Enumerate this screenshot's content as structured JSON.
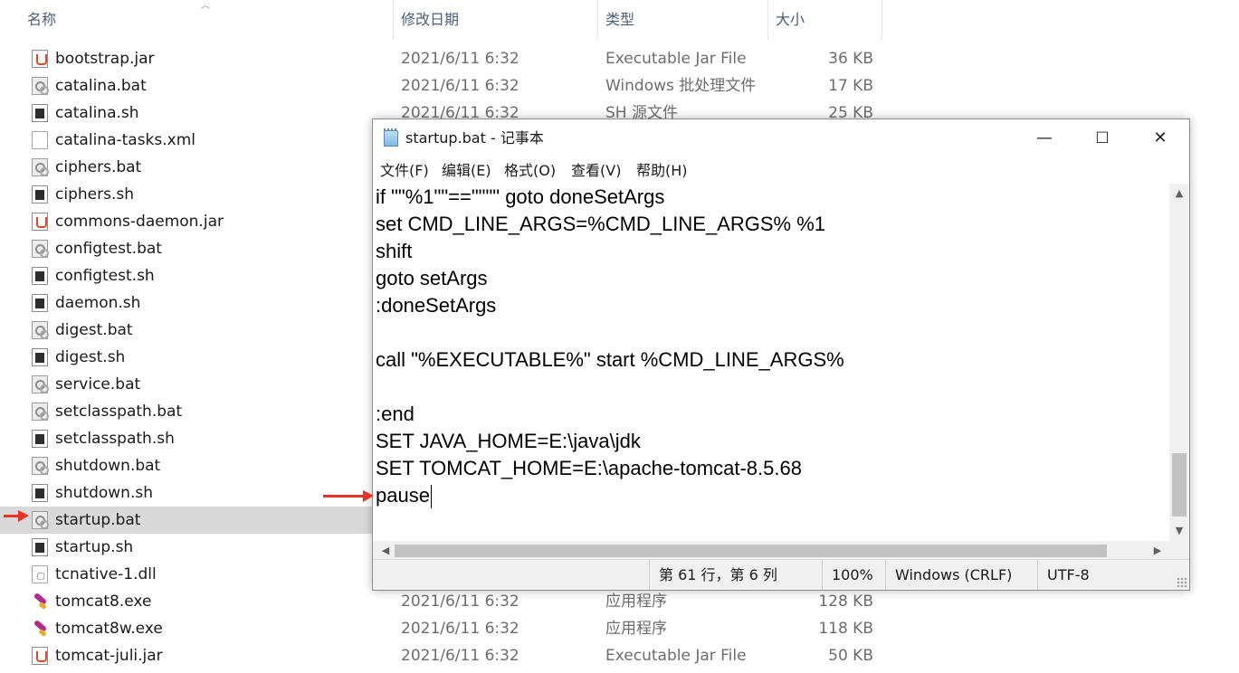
{
  "explorer": {
    "columns": {
      "name": "名称",
      "date": "修改日期",
      "type": "类型",
      "size": "大小"
    },
    "files": [
      {
        "name": "bootstrap.jar",
        "date": "2021/6/11 6:32",
        "type": "Executable Jar File",
        "size": "36 KB",
        "icon": "jar-file-icon"
      },
      {
        "name": "catalina.bat",
        "date": "2021/6/11 6:32",
        "type": "Windows 批处理文件",
        "size": "17 KB",
        "icon": "batch-file-icon"
      },
      {
        "name": "catalina.sh",
        "date": "2021/6/11 6:32",
        "type": "SH 源文件",
        "size": "25 KB",
        "icon": "shell-file-icon"
      },
      {
        "name": "catalina-tasks.xml",
        "date": "",
        "type": "",
        "size": "",
        "icon": "xml-file-icon"
      },
      {
        "name": "ciphers.bat",
        "date": "",
        "type": "",
        "size": "",
        "icon": "batch-file-icon"
      },
      {
        "name": "ciphers.sh",
        "date": "",
        "type": "",
        "size": "",
        "icon": "shell-file-icon"
      },
      {
        "name": "commons-daemon.jar",
        "date": "",
        "type": "",
        "size": "",
        "icon": "jar-file-icon"
      },
      {
        "name": "configtest.bat",
        "date": "",
        "type": "",
        "size": "",
        "icon": "batch-file-icon"
      },
      {
        "name": "configtest.sh",
        "date": "",
        "type": "",
        "size": "",
        "icon": "shell-file-icon"
      },
      {
        "name": "daemon.sh",
        "date": "",
        "type": "",
        "size": "",
        "icon": "shell-file-icon"
      },
      {
        "name": "digest.bat",
        "date": "",
        "type": "",
        "size": "",
        "icon": "batch-file-icon"
      },
      {
        "name": "digest.sh",
        "date": "",
        "type": "",
        "size": "",
        "icon": "shell-file-icon"
      },
      {
        "name": "service.bat",
        "date": "",
        "type": "",
        "size": "",
        "icon": "batch-file-icon"
      },
      {
        "name": "setclasspath.bat",
        "date": "",
        "type": "",
        "size": "",
        "icon": "batch-file-icon"
      },
      {
        "name": "setclasspath.sh",
        "date": "",
        "type": "",
        "size": "",
        "icon": "shell-file-icon"
      },
      {
        "name": "shutdown.bat",
        "date": "",
        "type": "",
        "size": "",
        "icon": "batch-file-icon"
      },
      {
        "name": "shutdown.sh",
        "date": "",
        "type": "",
        "size": "",
        "icon": "shell-file-icon"
      },
      {
        "name": "startup.bat",
        "date": "",
        "type": "",
        "size": "",
        "icon": "batch-file-icon",
        "selected": true
      },
      {
        "name": "startup.sh",
        "date": "",
        "type": "",
        "size": "",
        "icon": "shell-file-icon"
      },
      {
        "name": "tcnative-1.dll",
        "date": "",
        "type": "",
        "size": "",
        "icon": "dll-file-icon"
      },
      {
        "name": "tomcat8.exe",
        "date": "2021/6/11 6:32",
        "type": "应用程序",
        "size": "128 KB",
        "icon": "exe-file-icon"
      },
      {
        "name": "tomcat8w.exe",
        "date": "2021/6/11 6:32",
        "type": "应用程序",
        "size": "118 KB",
        "icon": "exe-file-icon"
      },
      {
        "name": "tomcat-juli.jar",
        "date": "2021/6/11 6:32",
        "type": "Executable Jar File",
        "size": "50 KB",
        "icon": "jar-file-icon"
      }
    ]
  },
  "notepad": {
    "title": "startup.bat - 记事本",
    "window_buttons": {
      "minimize": "—",
      "maximize": "☐",
      "close": "✕"
    },
    "menu": [
      "文件(F)",
      "编辑(E)",
      "格式(O)",
      "查看(V)",
      "帮助(H)"
    ],
    "lines": [
      "if \"\"%1\"\"==\"\"\"\" goto doneSetArgs",
      "set CMD_LINE_ARGS=%CMD_LINE_ARGS% %1",
      "shift",
      "goto setArgs",
      ":doneSetArgs",
      "",
      "call \"%EXECUTABLE%\" start %CMD_LINE_ARGS%",
      "",
      ":end",
      "SET JAVA_HOME=E:\\java\\jdk",
      "SET TOMCAT_HOME=E:\\apache-tomcat-8.5.68",
      "pause"
    ],
    "status": {
      "position": "第 61 行，第 6 列",
      "zoom": "100%",
      "line_ending": "Windows (CRLF)",
      "encoding": "UTF-8"
    }
  },
  "colors": {
    "arrow": "#e8322a",
    "selected_row": "#d9d9d9"
  }
}
